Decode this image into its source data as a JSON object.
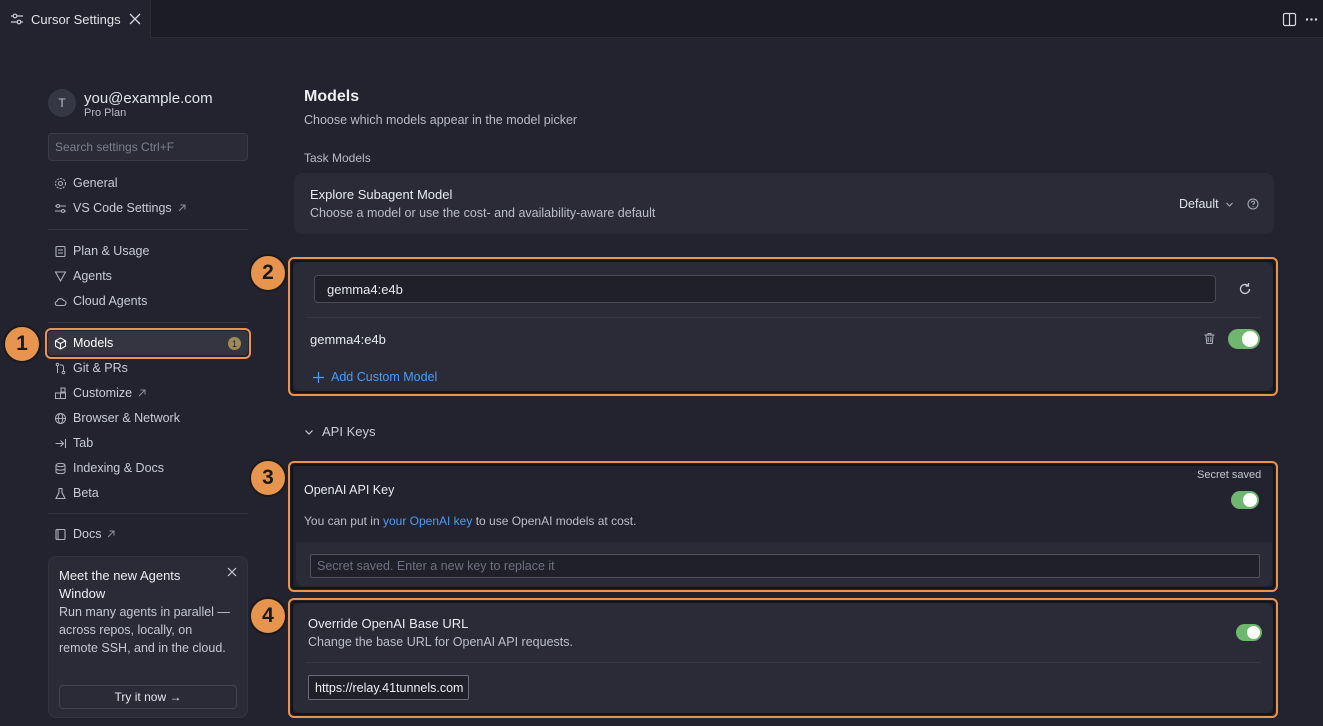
{
  "tab": {
    "title": "Cursor Settings"
  },
  "user": {
    "avatar_initial": "T",
    "email": "you@example.com",
    "plan": "Pro Plan"
  },
  "search": {
    "placeholder": "Search settings Ctrl+F"
  },
  "nav": {
    "general": "General",
    "vscode": "VS Code Settings",
    "plan_usage": "Plan & Usage",
    "agents": "Agents",
    "cloud_agents": "Cloud Agents",
    "models": "Models",
    "models_badge": "1",
    "git_prs": "Git & PRs",
    "customize": "Customize",
    "browser_network": "Browser & Network",
    "tab": "Tab",
    "indexing_docs": "Indexing & Docs",
    "beta": "Beta",
    "docs": "Docs"
  },
  "promo": {
    "title": "Meet the new Agents Window",
    "body": "Run many agents in parallel — across repos, locally, on remote SSH, and in the cloud.",
    "button": "Try it now →"
  },
  "main": {
    "title": "Models",
    "subtitle": "Choose which models appear in the model picker",
    "task_models_label": "Task Models",
    "explore": {
      "title": "Explore Subagent Model",
      "desc": "Choose a model or use the cost- and availability-aware default",
      "value": "Default"
    },
    "custom": {
      "input_value": "gemma4:e4b",
      "model_name": "gemma4:e4b",
      "model_enabled": true,
      "add_label": "Add Custom Model"
    },
    "api_keys_label": "API Keys",
    "openai": {
      "title": "OpenAI API Key",
      "status": "Secret saved",
      "desc_prefix": "You can put in ",
      "desc_link": "your OpenAI key",
      "desc_suffix": " to use OpenAI models at cost.",
      "enabled": true,
      "key_placeholder": "Secret saved. Enter a new key to replace it"
    },
    "base_url": {
      "title": "Override OpenAI Base URL",
      "desc": "Change the base URL for OpenAI API requests.",
      "enabled": true,
      "value": "https://relay.41tunnels.com"
    }
  },
  "callouts": {
    "one": "1",
    "two": "2",
    "three": "3",
    "four": "4"
  },
  "colors": {
    "accent_orange": "#e6944e",
    "toggle_green": "#6fb76f",
    "link_blue": "#4b9cf5"
  }
}
